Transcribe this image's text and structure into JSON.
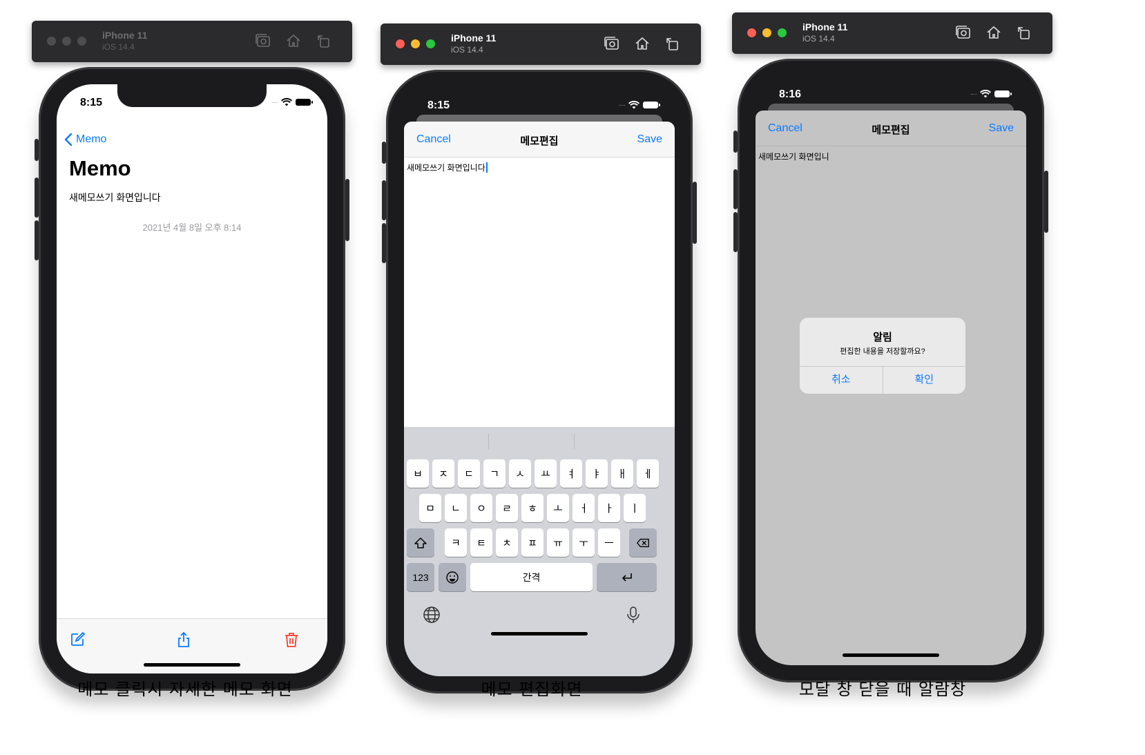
{
  "simulators": [
    {
      "device_name": "iPhone 11",
      "os_version": "iOS 14.4",
      "status_time": "8:15",
      "back_label": "Memo",
      "title": "Memo",
      "content": "새메모쓰기 화면입니다",
      "date": "2021년 4월 8일 오후 8:14",
      "caption": "메모 클릭시 자세한 메모 화면"
    },
    {
      "device_name": "iPhone 11",
      "os_version": "iOS 14.4",
      "status_time": "8:15",
      "cancel_label": "Cancel",
      "title": "메모편집",
      "save_label": "Save",
      "content": "새메모쓰기 화면입니다",
      "keyboard": {
        "row1": [
          "ㅂ",
          "ㅈ",
          "ㄷ",
          "ㄱ",
          "ㅅ",
          "ㅛ",
          "ㅕ",
          "ㅑ",
          "ㅐ",
          "ㅔ"
        ],
        "row2": [
          "ㅁ",
          "ㄴ",
          "ㅇ",
          "ㄹ",
          "ㅎ",
          "ㅗ",
          "ㅓ",
          "ㅏ",
          "ㅣ"
        ],
        "row3": [
          "ㅋ",
          "ㅌ",
          "ㅊ",
          "ㅍ",
          "ㅠ",
          "ㅜ",
          "ㅡ"
        ],
        "numbers_label": "123",
        "space_label": "간격"
      },
      "caption": "메모 편집화면"
    },
    {
      "device_name": "iPhone 11",
      "os_version": "iOS 14.4",
      "status_time": "8:16",
      "cancel_label": "Cancel",
      "title": "메모편집",
      "save_label": "Save",
      "content": "새메모쓰기 화면입니",
      "alert": {
        "title": "알림",
        "message": "편집한 내용을 저장할까요?",
        "cancel": "취소",
        "confirm": "확인"
      },
      "caption": "모달 창 닫을 때 알람창"
    }
  ],
  "colors": {
    "ios_blue": "#0a7aff",
    "delete_red": "#ff3b30",
    "traffic_red": "#fe5f57",
    "traffic_yellow": "#febc2e",
    "traffic_green": "#28c840"
  },
  "icons": {
    "titlebar": [
      "screenshot-icon",
      "home-icon",
      "rotate-icon"
    ],
    "toolbar": [
      "compose-icon",
      "share-icon",
      "trash-icon"
    ],
    "keyboard": [
      "shift-icon",
      "backspace-icon",
      "emoji-icon",
      "return-icon",
      "globe-icon",
      "microphone-icon"
    ]
  }
}
